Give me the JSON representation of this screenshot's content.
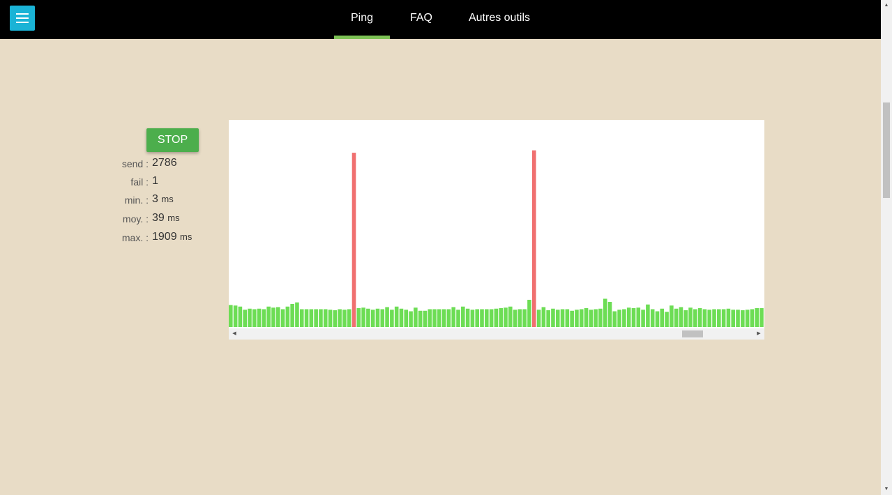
{
  "nav": {
    "tabs": [
      {
        "label": "Ping",
        "active": true
      },
      {
        "label": "FAQ",
        "active": false
      },
      {
        "label": "Autres outils",
        "active": false
      }
    ]
  },
  "controls": {
    "stop_label": "STOP"
  },
  "stats": {
    "send": {
      "label": "send :",
      "value": "2786",
      "unit": ""
    },
    "fail": {
      "label": "fail :",
      "value": "1",
      "unit": ""
    },
    "min": {
      "label": "min. :",
      "value": "3",
      "unit": "ms"
    },
    "avg": {
      "label": "moy. :",
      "value": "39",
      "unit": "ms"
    },
    "max": {
      "label": "max. :",
      "value": "1909",
      "unit": "ms"
    }
  },
  "colors": {
    "ok_bar": "#6ddd55",
    "error_bar": "#f07070",
    "menu_button": "#1ab3d6",
    "stop_button": "#4cae4c",
    "active_tab_underline": "#7ec255"
  },
  "icons": {
    "menu": "hamburger-icon",
    "scroll_left": "arrow-left-icon",
    "scroll_right": "arrow-right-icon"
  },
  "chart_data": {
    "type": "bar",
    "values": [
      42,
      41,
      39,
      33,
      35,
      34,
      35,
      34,
      39,
      37,
      38,
      34,
      39,
      44,
      47,
      34,
      34,
      34,
      34,
      34,
      34,
      33,
      32,
      34,
      33,
      34,
      1909,
      36,
      37,
      35,
      33,
      35,
      34,
      38,
      33,
      39,
      35,
      33,
      30,
      37,
      31,
      31,
      34,
      34,
      34,
      34,
      34,
      38,
      33,
      39,
      35,
      33,
      34,
      34,
      34,
      34,
      35,
      36,
      37,
      39,
      33,
      34,
      34,
      52,
      1940,
      33,
      38,
      32,
      35,
      33,
      34,
      34,
      31,
      33,
      34,
      36,
      33,
      34,
      35,
      54,
      48,
      30,
      33,
      34,
      37,
      36,
      37,
      33,
      43,
      34,
      30,
      35,
      29,
      41,
      35,
      38,
      32,
      37,
      34,
      36,
      34,
      33,
      34,
      34,
      34,
      35,
      33,
      33,
      32,
      33,
      34,
      36,
      36
    ],
    "errors": [
      26,
      64
    ],
    "ylim": [
      0,
      2000
    ]
  }
}
